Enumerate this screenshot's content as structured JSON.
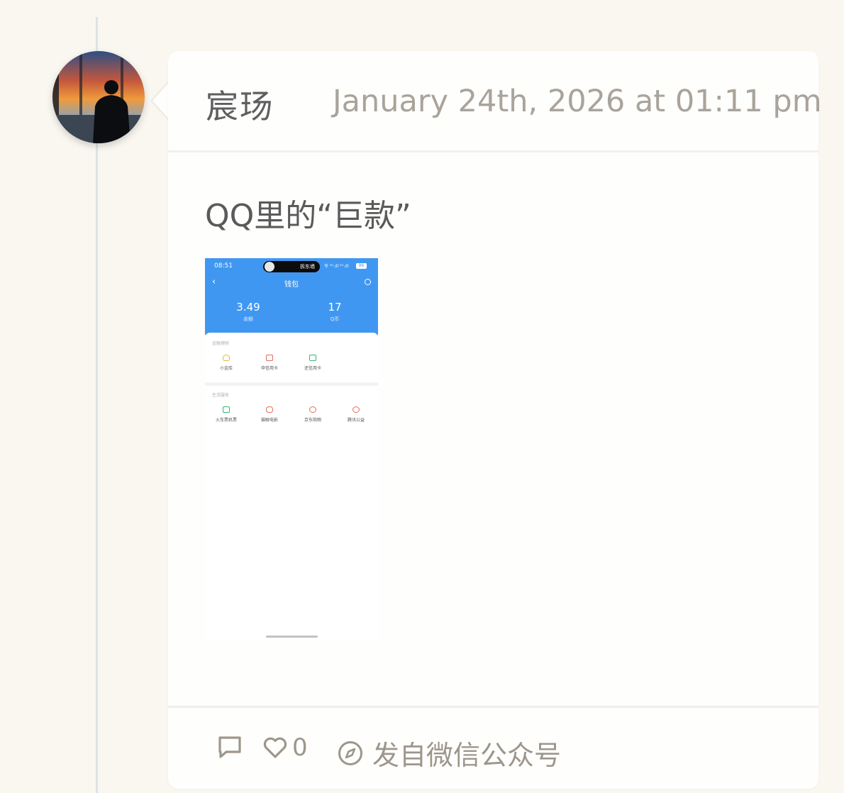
{
  "post": {
    "author": "宸玚",
    "timestamp": "January 24th, 2026 at 01:11 pm",
    "text": "QQ里的“巨款”",
    "likes": "0",
    "source": "发自微信公众号"
  },
  "screenshot": {
    "status_time": "08:51",
    "island_text": "拆东墙",
    "signal_text": "令 ⁵ᴳ.ıll ⁵ᴳ.ıll",
    "battery": "96",
    "title": "钱包",
    "balance_value": "3.49",
    "balance_label": "余额",
    "coins_value": "17",
    "coins_label": "Q币",
    "section1_title": "金融理财",
    "section1_items": [
      "小金库",
      "申信用卡",
      "还信用卡"
    ],
    "section2_title": "生活服务",
    "section2_items": [
      "火车票机票",
      "猫眼电影",
      "京东购物",
      "腾讯公益"
    ]
  },
  "colors": {
    "page_bg": "#faf7f1",
    "card_bg": "#fefefd",
    "wallet_blue": "#4097f1",
    "muted_text": "#a9a39a"
  },
  "icons": [
    "comment-icon",
    "heart-icon",
    "compass-icon",
    "back-chevron-icon",
    "settings-icon"
  ]
}
